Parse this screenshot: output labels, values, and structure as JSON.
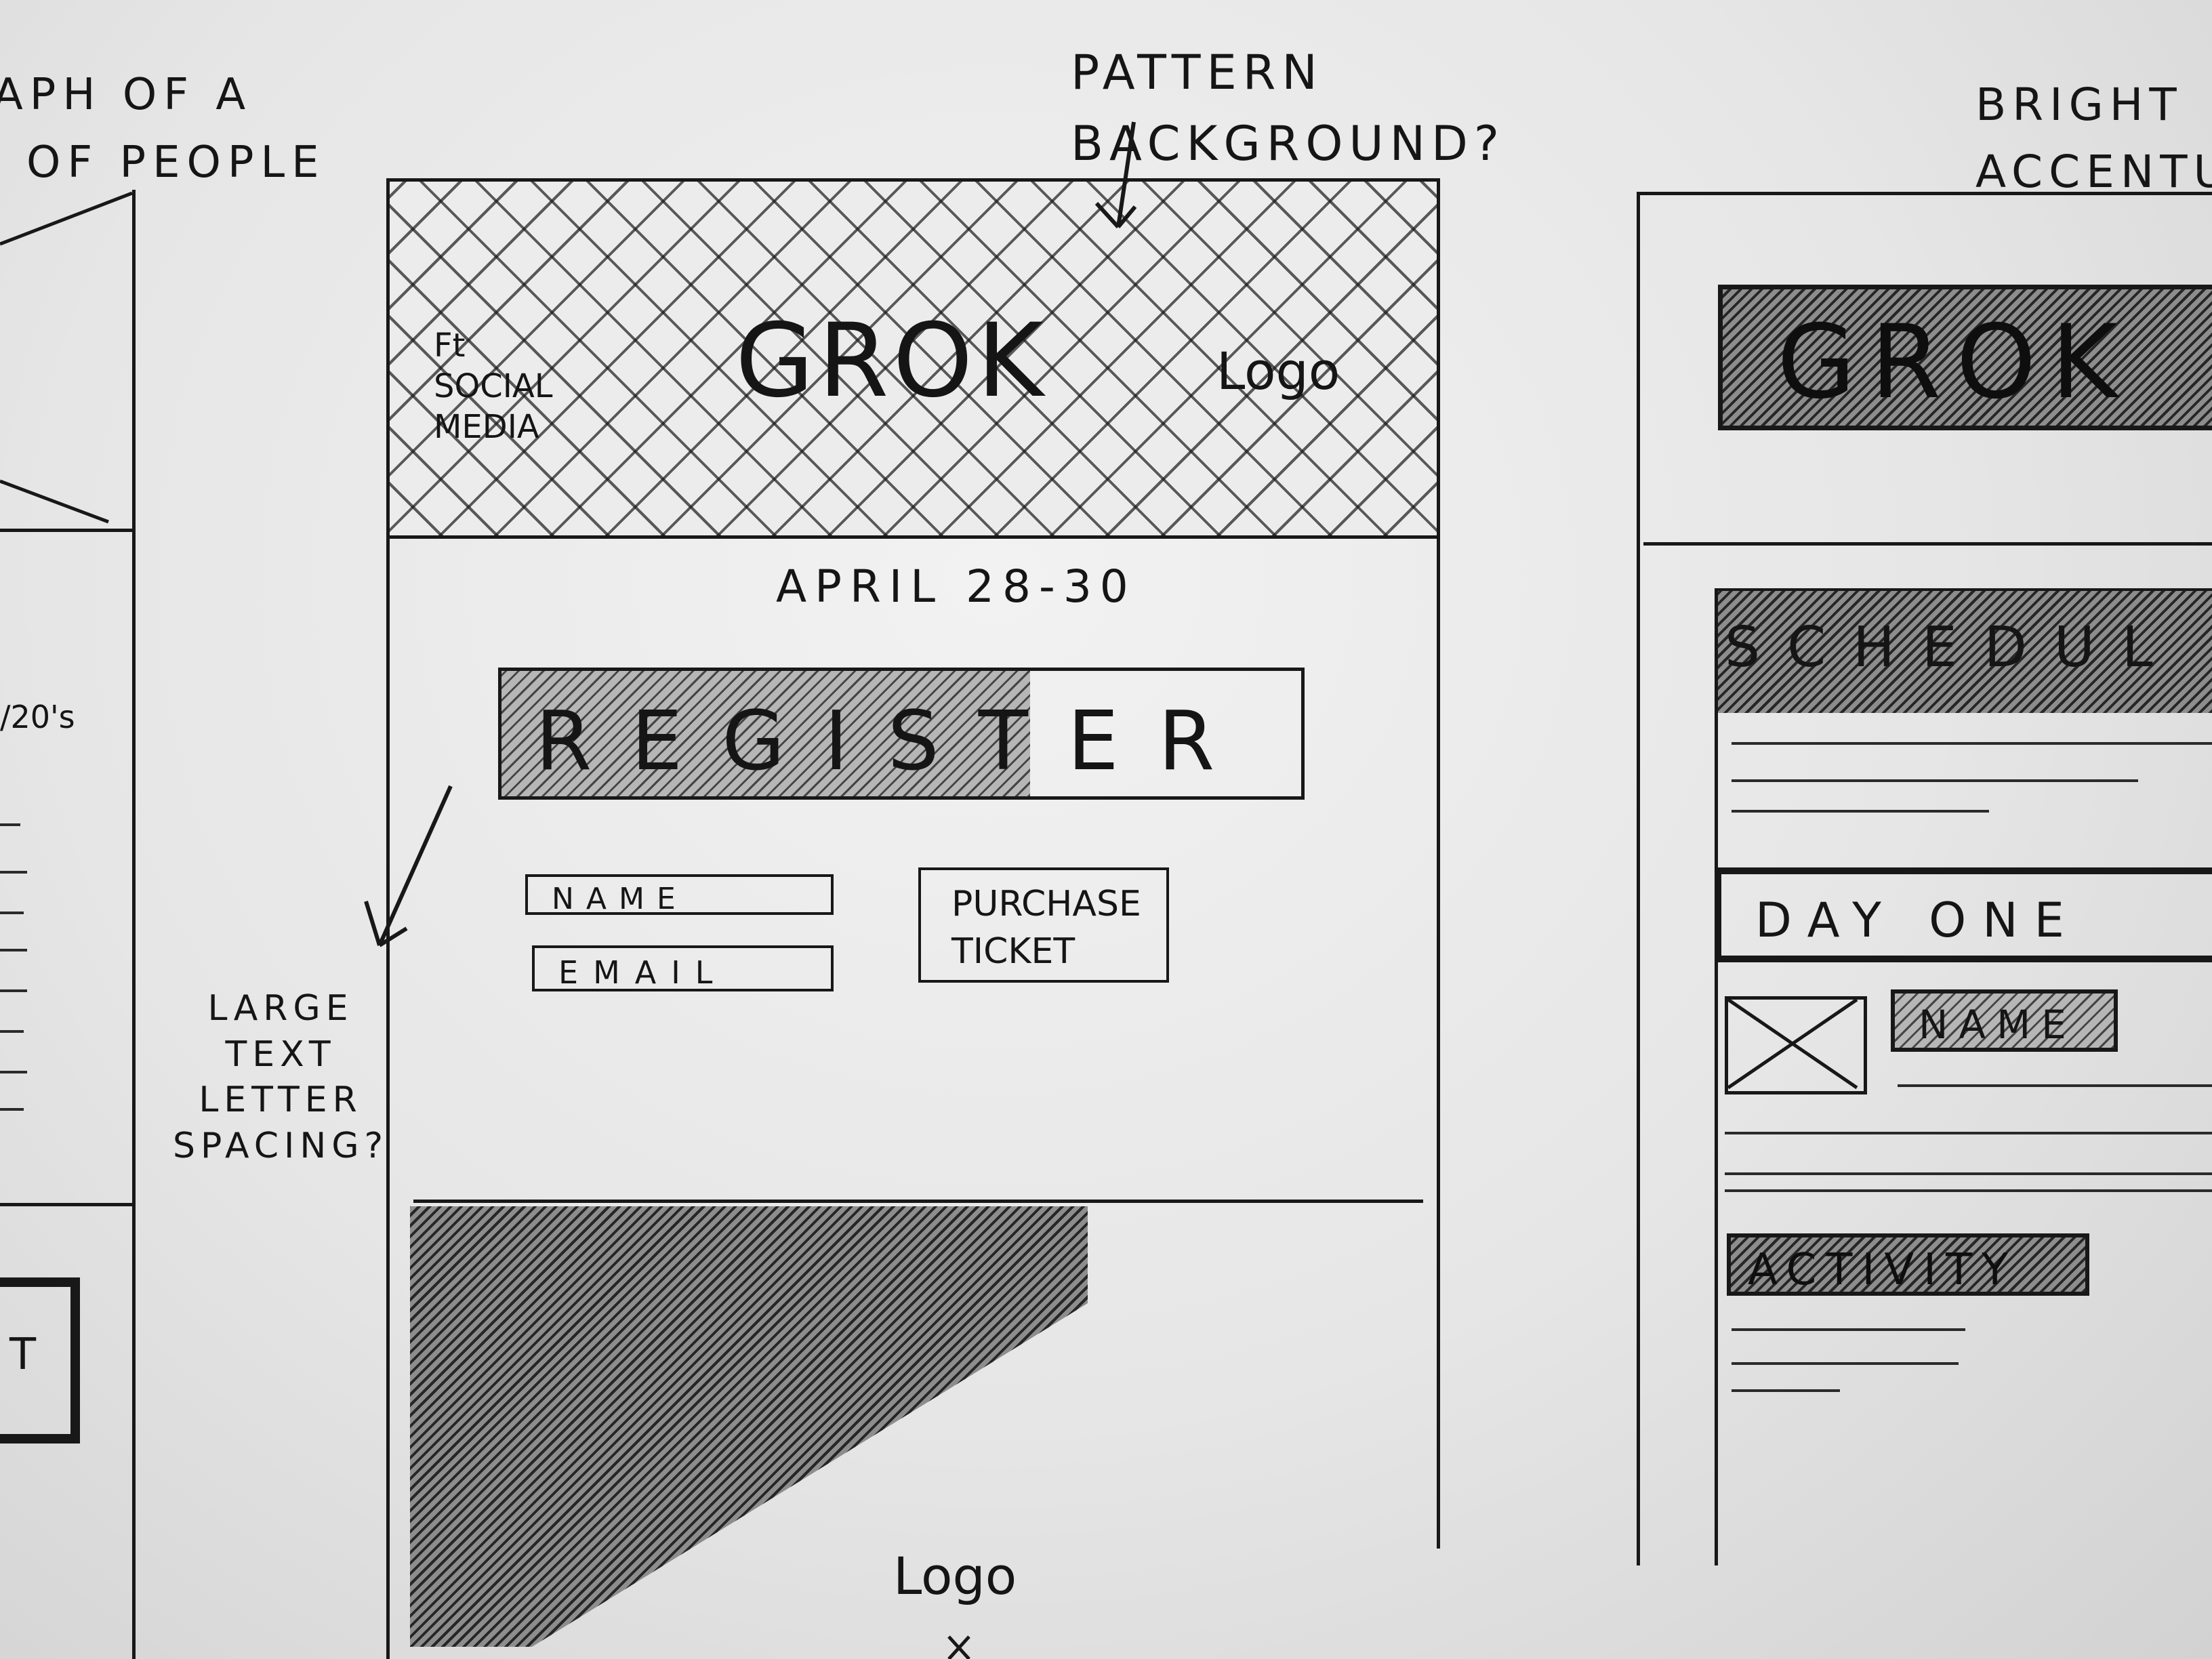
{
  "left_sketch": {
    "caption_line1": "APH OF A",
    "caption_line2": "P OF PEOPLE",
    "date_fragment": "/20's",
    "button_fragment": "T"
  },
  "center_sketch": {
    "annotation_pattern": "PATTERN\nBACKGROUND?",
    "header": {
      "social": "Ft\nSOCIAL\nMEDIA",
      "title": "GROK",
      "logo": "Logo"
    },
    "dates": "APRIL 28-30",
    "register": "REGISTER",
    "fields": {
      "name": "NAME",
      "email": "EMAIL"
    },
    "purchase_button": "PURCHASE\nTICKET",
    "annotation_letter_spacing": "LARGE\nTEXT\nLETTER\nSPACING?",
    "footer_logo": "Logo"
  },
  "right_sketch": {
    "annotation": "BRIGHT\nACCENTU",
    "title": "GROK",
    "schedule": "SCHEDUL",
    "day_one": "DAY ONE",
    "name_tag": "NAME",
    "activity": "ACTIVITY"
  }
}
